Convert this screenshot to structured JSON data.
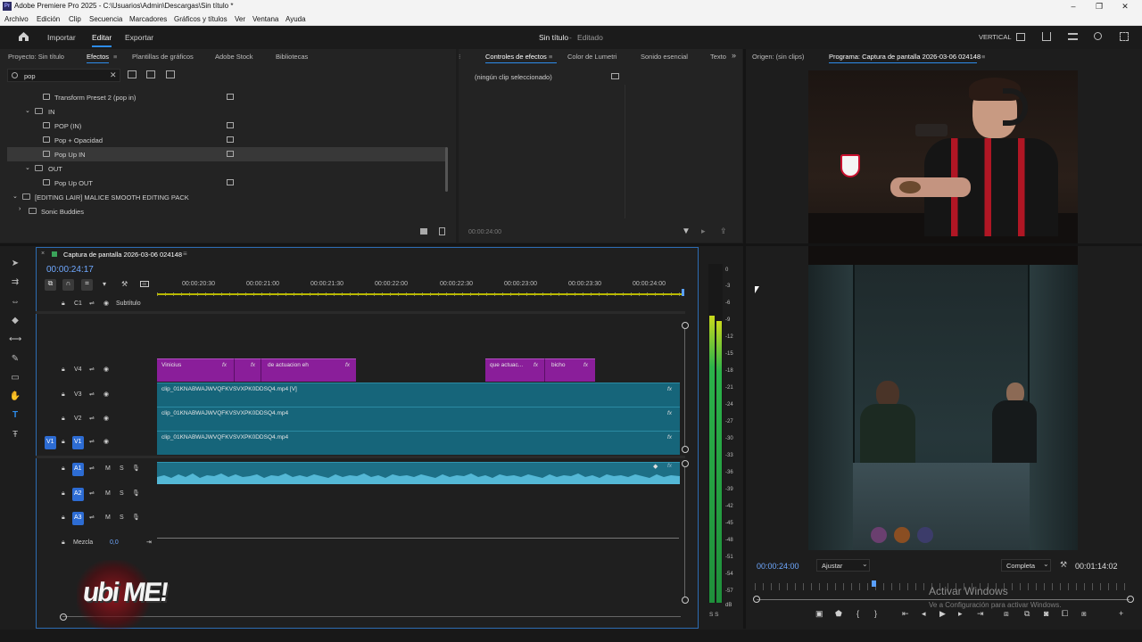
{
  "window": {
    "title": "Adobe Premiere Pro 2025 - C:\\Usuarios\\Admin\\Descargas\\Sin título *",
    "app_icon": "Pr"
  },
  "menu": [
    "Archivo",
    "Edición",
    "Clip",
    "Secuencia",
    "Marcadores",
    "Gráficos y títulos",
    "Ver",
    "Ventana",
    "Ayuda"
  ],
  "header": {
    "home_icon": "home-icon",
    "tabs": [
      "Importar",
      "Editar",
      "Exportar"
    ],
    "active_tab": "Editar",
    "project_title": "Sin título",
    "status": "Editado",
    "layout_label": "VERTICAL"
  },
  "effects_panel": {
    "tabs": [
      "Proyecto: Sin título",
      "Efectos",
      "Plantillas de gráficos",
      "Adobe Stock",
      "Bibliotecas"
    ],
    "active_tab": "Efectos",
    "search_value": "pop",
    "tree": [
      {
        "label": "Transform Preset 2 (pop in)",
        "type": "preset"
      },
      {
        "label": "IN",
        "type": "folder"
      },
      {
        "label": "POP (IN)",
        "type": "preset"
      },
      {
        "label": "Pop + Opacidad",
        "type": "preset"
      },
      {
        "label": "Pop Up IN",
        "type": "preset",
        "selected": true
      },
      {
        "label": "OUT",
        "type": "folder"
      },
      {
        "label": "Pop Up OUT",
        "type": "preset"
      },
      {
        "label": "[EDITING LAIR] MALICE SMOOTH EDITING PACK",
        "type": "folder"
      },
      {
        "label": "Sonic Buddies",
        "type": "folder"
      }
    ]
  },
  "effect_controls": {
    "tabs": [
      "Controles de efectos",
      "Color de Lumetri",
      "Sonido esencial",
      "Texto"
    ],
    "active_tab": "Controles de efectos",
    "no_clip": "(ningún clip seleccionado)",
    "timecode": "00:00:24:00"
  },
  "monitor": {
    "tabs": [
      "Origen: (sin clips)",
      "Programa: Captura de pantalla 2026-03-06 024148"
    ],
    "timecode": "00:00:24:00",
    "fit": "Ajustar",
    "quality": "Completa",
    "duration": "00:01:14:02",
    "activation_title": "Activar Windows",
    "activation_sub": "Ve a Configuración para activar Windows."
  },
  "timeline": {
    "sequence_name": "Captura de pantalla 2026-03-06 024148",
    "timecode": "00:00:24:17",
    "ruler": [
      "00:00:20:30",
      "00:00:21:00",
      "00:00:21:30",
      "00:00:22:00",
      "00:00:22:30",
      "00:00:23:00",
      "00:00:23:30",
      "00:00:24:00"
    ],
    "tracks": {
      "c1": {
        "id": "C1",
        "name": "Subtítulo"
      },
      "video": [
        "V4",
        "V3",
        "V2",
        "V1"
      ],
      "audio": [
        "A1",
        "A2",
        "A3"
      ],
      "mix": {
        "label": "Mezcla",
        "value": "0,0"
      },
      "source_patch": "V1"
    },
    "clips": {
      "v4": [
        {
          "label": "Vinicius"
        },
        {
          "label": "de actuacion eh"
        },
        {
          "label": "que actuac..."
        },
        {
          "label": "bicho"
        }
      ],
      "v3": "clip_01KNABWAJWVQFKVSVXPK0DDSQ4.mp4 [V]",
      "v2": "clip_01KNABWAJWVQFKVSVXPK0DDSQ4.mp4",
      "v1": "clip_01KNABWAJWVQFKVSVXPK0DDSQ4.mp4",
      "fx_badge": "fx"
    }
  },
  "meter_scale": [
    "0",
    "-3",
    "-6",
    "-9",
    "-12",
    "-15",
    "-18",
    "-21",
    "-24",
    "-27",
    "-30",
    "-33",
    "-36",
    "-39",
    "-42",
    "-45",
    "-48",
    "-51",
    "-54",
    "-57",
    "dB"
  ],
  "meter_footer": "S S",
  "watermark": "ubi ME!",
  "colors": {
    "accent": "#2d8ceb",
    "timecode": "#6fa8ff",
    "video_clip": "#16657a",
    "graphic_clip": "#8a1e9a",
    "audio_clip": "#1d6f86",
    "meter": "#28b34a"
  }
}
